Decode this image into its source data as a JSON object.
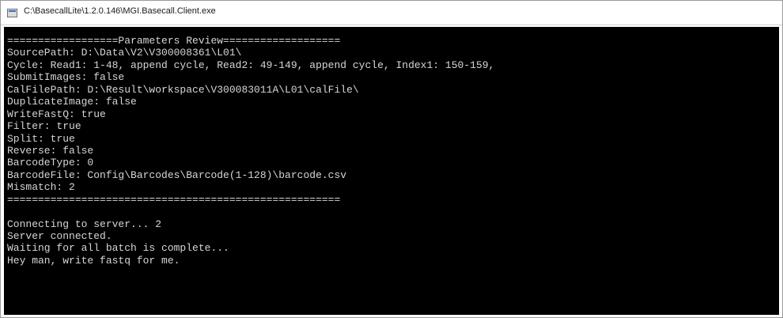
{
  "window": {
    "title": "C:\\BasecallLite\\1.2.0.146\\MGI.Basecall.Client.exe",
    "title_icon": "console-window-icon"
  },
  "console": {
    "lines": [
      "==================Parameters Review===================",
      "SourcePath: D:\\Data\\V2\\V300008361\\L01\\",
      "Cycle: Read1: 1-48, append cycle, Read2: 49-149, append cycle, Index1: 150-159,",
      "SubmitImages: false",
      "CalFilePath: D:\\Result\\workspace\\V300083011A\\L01\\calFile\\",
      "DuplicateImage: false",
      "WriteFastQ: true",
      "Filter: true",
      "Split: true",
      "Reverse: false",
      "BarcodeType: 0",
      "BarcodeFile: Config\\Barcodes\\Barcode(1-128)\\barcode.csv",
      "Mismatch: 2",
      "======================================================",
      "",
      "Connecting to server... 2",
      "Server connected.",
      "Waiting for all batch is complete...",
      "Hey man, write fastq for me."
    ]
  }
}
